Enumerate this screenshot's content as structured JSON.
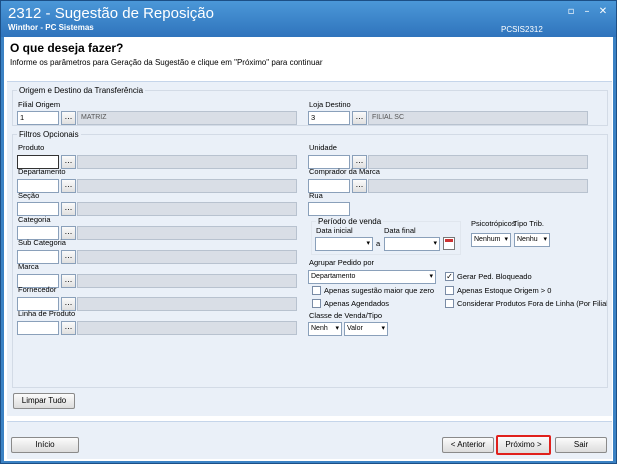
{
  "window": {
    "title": "2312 - Sugestão de Reposição",
    "subtitle": "Winthor - PC Sistemas",
    "code": "PCSIS2312",
    "controls": {
      "restore": "▫",
      "minimize": "–",
      "close": "✕"
    }
  },
  "header": {
    "heading": "O que deseja fazer?",
    "instructions": "Informe os parâmetros para Geração da Sugestão e clique em \"Próximo\" para continuar"
  },
  "origin_destination": {
    "legend": "Origem e Destino da Transferência",
    "filial_origem": {
      "label": "Filial Origem",
      "value": "1",
      "name": "MATRIZ"
    },
    "loja_destino": {
      "label": "Loja Destino",
      "value": "3",
      "name": "FILIAL SC"
    },
    "lookup_label": "..."
  },
  "filters": {
    "legend": "Filtros Opcionais",
    "produto": "Produto",
    "departamento": "Departamento",
    "secao": "Seção",
    "categoria": "Categoria",
    "sub_categoria": "Sub Categoria",
    "marca": "Marca",
    "fornecedor": "Fornecedor",
    "linha_produto": "Linha de Produto",
    "unidade": "Unidade",
    "comprador_marca": "Comprador da Marca",
    "rua": "Rua",
    "periodo": {
      "legend": "Período de venda",
      "data_inicial": "Data inicial",
      "data_final": "Data final",
      "separator": "a"
    },
    "psicotropicos": {
      "label": "Psicotrópicos",
      "value": "Nenhum"
    },
    "tipo_trib": {
      "label": "Tipo Trib.",
      "value": "Nenhu"
    },
    "agrupar": {
      "label": "Agrupar Pedido por",
      "value": "Departamento"
    },
    "checkboxes": {
      "gerar_ped": {
        "label": "Gerar Ped. Bloqueado",
        "checked": true
      },
      "sugestao_maior_zero": {
        "label": "Apenas sugestão maior que zero",
        "checked": false
      },
      "estoque_origem": {
        "label": "Apenas Estoque Origem > 0",
        "checked": false
      },
      "agendados": {
        "label": "Apenas Agendados",
        "checked": false
      },
      "fora_linha": {
        "label": "Considerar Produtos Fora de Linha (Por Filial)",
        "checked": false
      }
    },
    "classe_venda": {
      "label": "Classe de Venda/Tipo",
      "value1": "Nenh",
      "value2": "Valor"
    },
    "limpar_tudo": "Limpar Tudo"
  },
  "footer": {
    "inicio": "Início",
    "anterior": "< Anterior",
    "proximo": "Próximo >",
    "sair": "Sair"
  },
  "colors": {
    "titlebar": "#3b82c4",
    "panel": "#eaf0f8",
    "highlight": "#e0201c"
  },
  "icons": {
    "calendar": "calendar-icon",
    "check": "check-icon"
  }
}
